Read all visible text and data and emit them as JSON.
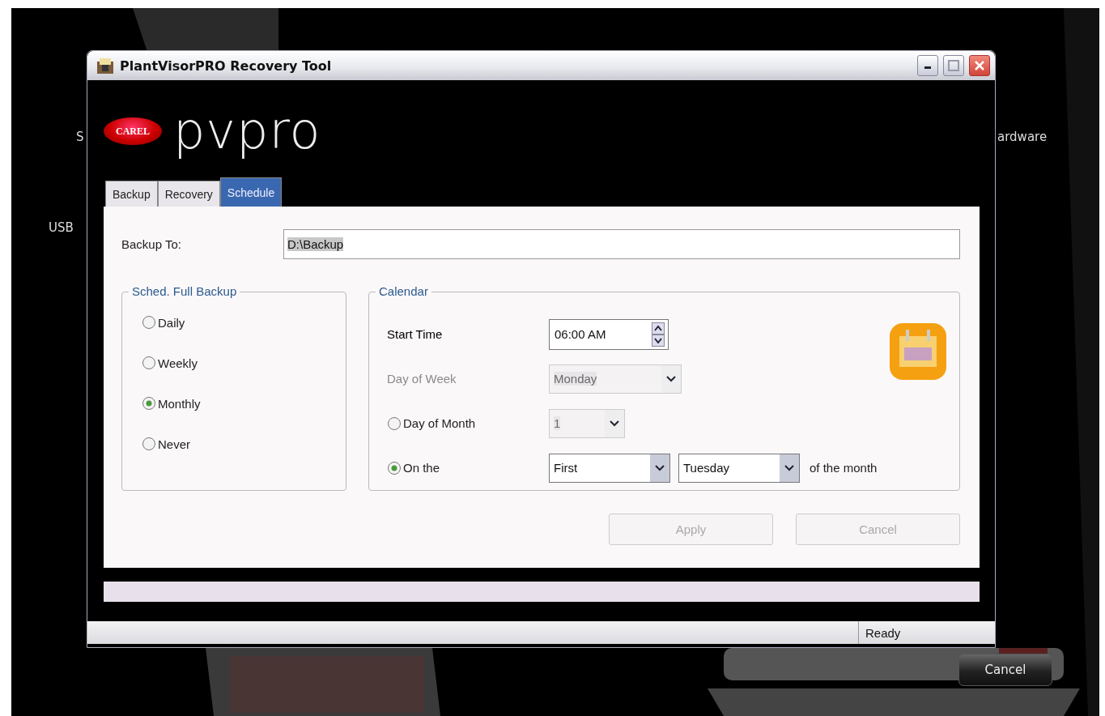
{
  "background": {
    "labels": [
      {
        "text": "S",
        "kind": "left"
      },
      {
        "text": "ardware",
        "kind": "right"
      },
      {
        "text": "USB",
        "kind": "left2"
      }
    ],
    "cancel_button": "Cancel"
  },
  "window": {
    "title": "PlantVisorPRO Recovery Tool"
  },
  "logo": {
    "badge": "CAREL",
    "wordmark": "pvpro"
  },
  "tabs": [
    {
      "label": "Backup",
      "selected": false
    },
    {
      "label": "Recovery",
      "selected": false
    },
    {
      "label": "Schedule",
      "selected": true
    }
  ],
  "backup_to": {
    "label": "Backup To:",
    "value": "D:\\Backup"
  },
  "schedule_group": {
    "title": "Sched. Full Backup",
    "options": [
      {
        "label": "Daily",
        "selected": false
      },
      {
        "label": "Weekly",
        "selected": false
      },
      {
        "label": "Monthly",
        "selected": true
      },
      {
        "label": "Never",
        "selected": false
      }
    ]
  },
  "calendar": {
    "title": "Calendar",
    "start_time": {
      "label": "Start Time",
      "value": "06:00 AM"
    },
    "day_of_week": {
      "label": "Day of Week",
      "value": "Monday",
      "disabled": true
    },
    "day_of_month": {
      "label": "Day of Month",
      "value": "1",
      "selected": false,
      "disabled": true
    },
    "on_the": {
      "label": "On the",
      "selected": true,
      "ordinal": "First",
      "weekday": "Tuesday",
      "suffix": "of the month"
    }
  },
  "buttons": [
    {
      "label": "Apply",
      "disabled": true
    },
    {
      "label": "Cancel",
      "disabled": true
    }
  ],
  "progress": {
    "level": 0
  },
  "status_bar": {
    "text": "Ready"
  }
}
